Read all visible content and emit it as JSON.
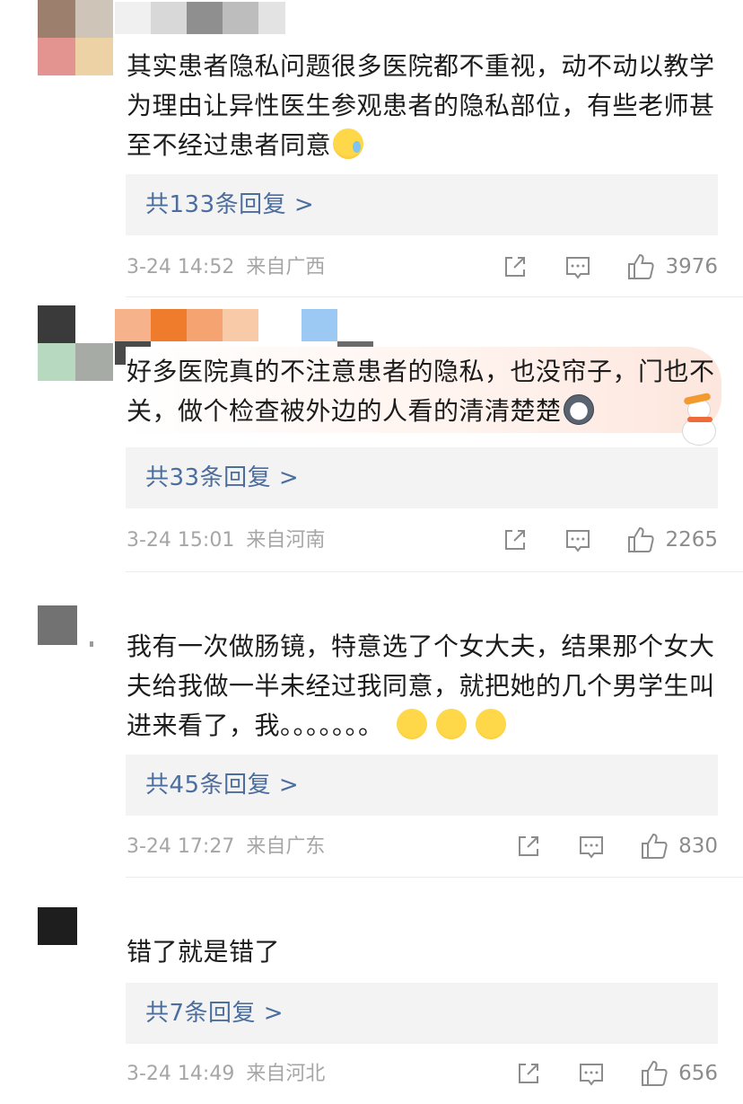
{
  "comments": [
    {
      "text": "其实患者隐私问题很多医院都不重视，动不动以教学为理由让异性医生参观患者的隐私部位，有些老师甚至不经过患者同意",
      "emoji": "sweat-smile-emoji",
      "reply_label": "共133条回复 >",
      "time": "3-24 14:52",
      "location": "来自广西",
      "likes": "3976"
    },
    {
      "text": "好多医院真的不注意患者的隐私，也没帘子，门也不关，做个检查被外边的人看的清清楚楚",
      "emoji": "husky-emoji",
      "reply_label": "共33条回复 >",
      "time": "3-24 15:01",
      "location": "来自河南",
      "likes": "2265"
    },
    {
      "text": "我有一次做肠镜，特意选了个女大夫，结果那个女大夫给我做一半未经过我同意，就把她的几个男学生叫进来看了，我。。。。。。。",
      "emoji": "laughing-crying-emoji",
      "reply_label": "共45条回复 >",
      "time": "3-24 17:27",
      "location": "来自广东",
      "likes": "830"
    },
    {
      "text": "错了就是错了",
      "reply_label": "共7条回复 >",
      "time": "3-24 14:49",
      "location": "来自河北",
      "likes": "656"
    }
  ],
  "colors": {
    "link": "#4c6e9e",
    "meta": "#a6a6a6",
    "reply_bg": "#f3f3f3"
  }
}
